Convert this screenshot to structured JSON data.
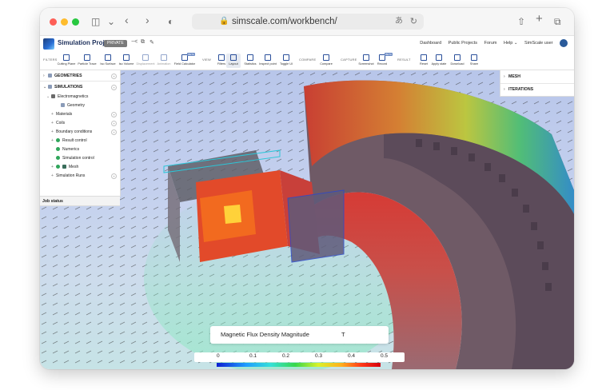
{
  "browser": {
    "url": "simscale.com/workbench/"
  },
  "app": {
    "project_title": "Simulation Project",
    "private_badge": "PRIVATE",
    "nav": [
      "Dashboard",
      "Public Projects",
      "Forum",
      "Help ⌄",
      "SimScale user"
    ]
  },
  "toolbar": {
    "filters_label": "FILTERS",
    "view_label": "VIEW",
    "compare_label": "COMPARE",
    "capture_label": "CAPTURE",
    "result_label": "RESULT",
    "beta": "BETA",
    "buttons": [
      {
        "label": "Cutting Plane"
      },
      {
        "label": "Particle Trace"
      },
      {
        "label": "Iso Surface"
      },
      {
        "label": "Iso Volume"
      },
      {
        "label": "Displacement"
      },
      {
        "label": "Animation"
      },
      {
        "label": "Field Calculator"
      },
      {
        "label": "Filters"
      },
      {
        "label": "Layout"
      },
      {
        "label": "Statistics"
      },
      {
        "label": "Inspect point"
      },
      {
        "label": "Toggle UI"
      },
      {
        "label": "Compare"
      },
      {
        "label": "Screenshot"
      },
      {
        "label": "Record"
      },
      {
        "label": "Reset"
      },
      {
        "label": "Apply state"
      },
      {
        "label": "Download"
      },
      {
        "label": "Share"
      }
    ]
  },
  "tree": {
    "geometries": "GEOMETRIES",
    "simulations": "SIMULATIONS",
    "electromagnetics": "Electromagnetics",
    "geometry": "Geometry",
    "materials": "Materials",
    "coils": "Coils",
    "boundary_conditions": "Boundary conditions",
    "result_control": "Result control",
    "numerics": "Numerics",
    "simulation_control": "Simulation control",
    "mesh": "Mesh",
    "simulation_runs": "Simulation Runs"
  },
  "job_status": "Job status",
  "right_panel": {
    "mesh": "MESH",
    "iterations": "ITERATIONS"
  },
  "legend": {
    "title": "Magnetic Flux Density Magnitude",
    "unit": "T",
    "ticks": [
      "0",
      "0.1",
      "0.2",
      "0.3",
      "0.4",
      "0.5"
    ]
  },
  "colors": {
    "accent": "#1b2e5a",
    "background_top": "#b8c6ea",
    "background_bottom": "#c6e3e6"
  }
}
